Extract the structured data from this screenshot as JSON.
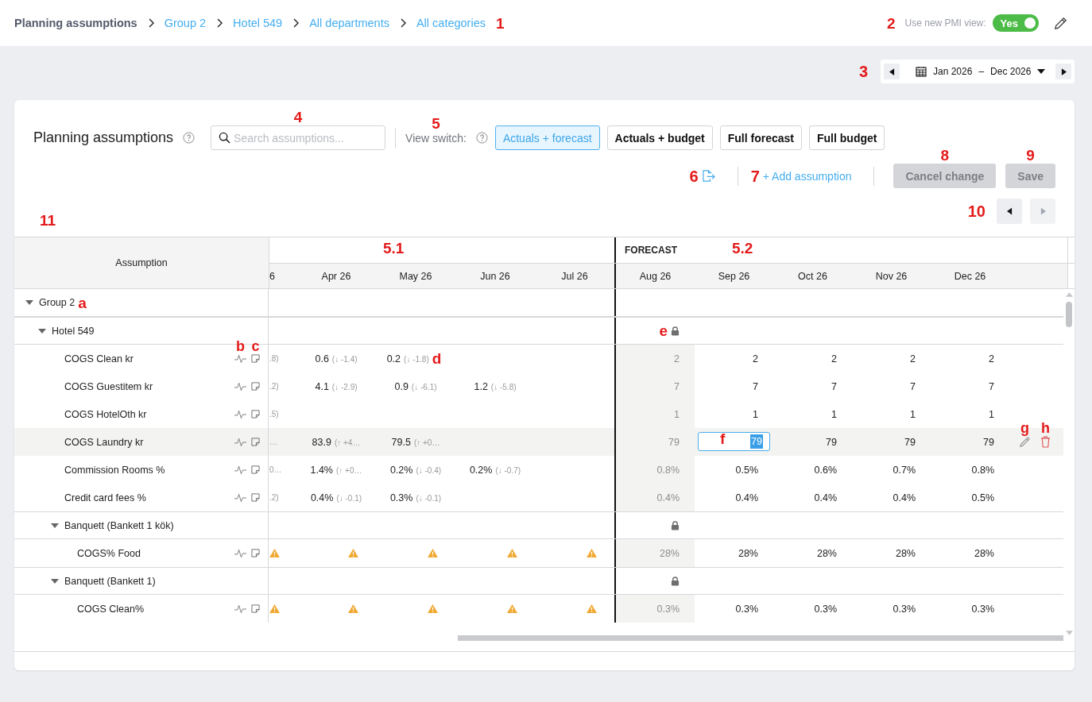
{
  "breadcrumbs": {
    "annotation": "1",
    "items": [
      {
        "label": "Planning assumptions",
        "kind": "current"
      },
      {
        "label": "Group 2",
        "kind": "link"
      },
      {
        "label": "Hotel 549",
        "kind": "link"
      },
      {
        "label": "All departments",
        "kind": "link"
      },
      {
        "label": "All categories",
        "kind": "link"
      }
    ]
  },
  "pmi_toggle": {
    "label": "Use new PMI view:",
    "on": true,
    "value": "Yes",
    "annotation": "2"
  },
  "date_range": {
    "from": "Jan 2026",
    "separator": "–",
    "to": "Dec 2026",
    "annotation": "3"
  },
  "card": {
    "title": "Planning assumptions",
    "search": {
      "placeholder": "Search assumptions...",
      "annotation": "4"
    },
    "view_switch": {
      "label": "View switch:",
      "annotation": "5",
      "options": [
        {
          "label": "Actuals + forecast",
          "selected": true
        },
        {
          "label": "Actuals + budget",
          "selected": false
        },
        {
          "label": "Full forecast",
          "selected": false
        },
        {
          "label": "Full budget",
          "selected": false
        }
      ]
    },
    "export_annotation": "6",
    "add_assumption": {
      "label": "+ Add assumption",
      "annotation": "7"
    },
    "cancel": {
      "label": "Cancel change",
      "disabled": true,
      "annotation": "8"
    },
    "save": {
      "label": "Save",
      "disabled": true,
      "annotation": "9"
    },
    "pager": {
      "annotation": "10",
      "buttons": [
        {
          "kind": "prev",
          "disabled": false
        },
        {
          "kind": "next",
          "disabled": true
        }
      ]
    },
    "table_annotation": "11"
  },
  "table": {
    "assumption_header": "Assumption",
    "actuals": {
      "annotation": "5.1",
      "months": [
        "6",
        "Apr 26",
        "May 26",
        "Jun 26",
        "Jul 26"
      ]
    },
    "forecast": {
      "title": "FORECAST",
      "annotation": "5.2",
      "months": [
        "Aug 26",
        "Sep 26",
        "Oct 26",
        "Nov 26",
        "Dec 26"
      ]
    },
    "rows": [
      {
        "kind": "group",
        "name": "Group 2",
        "expanded": true,
        "locked": false,
        "annotation": "a",
        "children": [
          {
            "kind": "group",
            "name": "Hotel 549",
            "expanded": true,
            "locked": true,
            "lock_annotation": "e",
            "children": [
              {
                "kind": "assumption",
                "name": "COGS Clean kr",
                "hovered": false,
                "icon_annotations": [
                  "b",
                  "c"
                ],
                "actuals": [
                  {
                    "kind": "value",
                    "value": ".8)"
                  },
                  {
                    "kind": "value",
                    "value": "0.6",
                    "delta": "(↓ -1.4)"
                  },
                  {
                    "kind": "value",
                    "value": "0.2",
                    "delta": "(↓ -1.8)",
                    "annotation": "d"
                  },
                  {
                    "kind": "empty"
                  },
                  {
                    "kind": "empty"
                  }
                ],
                "forecast": [
                  {
                    "kind": "actual",
                    "value": "2"
                  },
                  {
                    "kind": "value",
                    "value": "2"
                  },
                  {
                    "kind": "value",
                    "value": "2"
                  },
                  {
                    "kind": "value",
                    "value": "2"
                  },
                  {
                    "kind": "value",
                    "value": "2"
                  }
                ]
              },
              {
                "kind": "assumption",
                "name": "COGS Guestitem kr",
                "hovered": false,
                "actuals": [
                  {
                    "kind": "value",
                    "value": ".2)"
                  },
                  {
                    "kind": "value",
                    "value": "4.1",
                    "delta": "(↓ -2.9)"
                  },
                  {
                    "kind": "value",
                    "value": "0.9",
                    "delta": "(↓ -6.1)"
                  },
                  {
                    "kind": "value",
                    "value": "1.2",
                    "delta": "(↓ -5.8)"
                  },
                  {
                    "kind": "empty"
                  }
                ],
                "forecast": [
                  {
                    "kind": "actual",
                    "value": "7"
                  },
                  {
                    "kind": "value",
                    "value": "7"
                  },
                  {
                    "kind": "value",
                    "value": "7"
                  },
                  {
                    "kind": "value",
                    "value": "7"
                  },
                  {
                    "kind": "value",
                    "value": "7"
                  }
                ]
              },
              {
                "kind": "assumption",
                "name": "COGS HotelOth kr",
                "hovered": false,
                "actuals": [
                  {
                    "kind": "value",
                    "value": ".5)"
                  },
                  {
                    "kind": "empty"
                  },
                  {
                    "kind": "empty"
                  },
                  {
                    "kind": "empty"
                  },
                  {
                    "kind": "empty"
                  }
                ],
                "forecast": [
                  {
                    "kind": "actual",
                    "value": "1"
                  },
                  {
                    "kind": "value",
                    "value": "1"
                  },
                  {
                    "kind": "value",
                    "value": "1"
                  },
                  {
                    "kind": "value",
                    "value": "1"
                  },
                  {
                    "kind": "value",
                    "value": "1"
                  }
                ]
              },
              {
                "kind": "assumption",
                "name": "COGS Laundry kr",
                "hovered": true,
                "action_annotations": [
                  "g",
                  "h"
                ],
                "actuals": [
                  {
                    "kind": "value",
                    "value": "…"
                  },
                  {
                    "kind": "value",
                    "value": "83.9",
                    "delta": "(↑ +4…"
                  },
                  {
                    "kind": "value",
                    "value": "79.5",
                    "delta": "(↑ +0…"
                  },
                  {
                    "kind": "empty"
                  },
                  {
                    "kind": "empty"
                  }
                ],
                "forecast": [
                  {
                    "kind": "actual",
                    "value": "79"
                  },
                  {
                    "kind": "editing",
                    "value": "79",
                    "annotation": "f"
                  },
                  {
                    "kind": "value",
                    "value": "79"
                  },
                  {
                    "kind": "value",
                    "value": "79"
                  },
                  {
                    "kind": "value",
                    "value": "79"
                  }
                ]
              },
              {
                "kind": "assumption",
                "name": "Commission Rooms %",
                "hovered": false,
                "actuals": [
                  {
                    "kind": "value",
                    "value": "0…"
                  },
                  {
                    "kind": "value",
                    "value": "1.4%",
                    "delta": "(↑ +0…"
                  },
                  {
                    "kind": "value",
                    "value": "0.2%",
                    "delta": "(↓ -0.4)"
                  },
                  {
                    "kind": "value",
                    "value": "0.2%",
                    "delta": "(↓ -0.7)"
                  },
                  {
                    "kind": "empty"
                  }
                ],
                "forecast": [
                  {
                    "kind": "actual",
                    "value": "0.8%"
                  },
                  {
                    "kind": "value",
                    "value": "0.5%"
                  },
                  {
                    "kind": "value",
                    "value": "0.6%"
                  },
                  {
                    "kind": "value",
                    "value": "0.7%"
                  },
                  {
                    "kind": "value",
                    "value": "0.8%"
                  }
                ]
              },
              {
                "kind": "assumption",
                "name": "Credit card fees %",
                "hovered": false,
                "actuals": [
                  {
                    "kind": "value",
                    "value": ".2)"
                  },
                  {
                    "kind": "value",
                    "value": "0.4%",
                    "delta": "(↓ -0.1)"
                  },
                  {
                    "kind": "value",
                    "value": "0.3%",
                    "delta": "(↓ -0.1)"
                  },
                  {
                    "kind": "empty"
                  },
                  {
                    "kind": "empty"
                  }
                ],
                "forecast": [
                  {
                    "kind": "actual",
                    "value": "0.4%"
                  },
                  {
                    "kind": "value",
                    "value": "0.4%"
                  },
                  {
                    "kind": "value",
                    "value": "0.4%"
                  },
                  {
                    "kind": "value",
                    "value": "0.4%"
                  },
                  {
                    "kind": "value",
                    "value": "0.5%"
                  }
                ]
              },
              {
                "kind": "group",
                "name": "Banquett (Bankett 1 kök)",
                "expanded": true,
                "locked": true,
                "children": [
                  {
                    "kind": "assumption",
                    "name": "COGS% Food",
                    "hovered": false,
                    "actuals": [
                      {
                        "kind": "warning"
                      },
                      {
                        "kind": "warning"
                      },
                      {
                        "kind": "warning"
                      },
                      {
                        "kind": "warning"
                      },
                      {
                        "kind": "warning"
                      }
                    ],
                    "forecast": [
                      {
                        "kind": "actual",
                        "value": "28%"
                      },
                      {
                        "kind": "value",
                        "value": "28%"
                      },
                      {
                        "kind": "value",
                        "value": "28%"
                      },
                      {
                        "kind": "value",
                        "value": "28%"
                      },
                      {
                        "kind": "value",
                        "value": "28%"
                      }
                    ]
                  }
                ]
              },
              {
                "kind": "group",
                "name": "Banquett (Bankett 1)",
                "expanded": true,
                "locked": true,
                "children": [
                  {
                    "kind": "assumption",
                    "name": "COGS Clean%",
                    "hovered": false,
                    "actuals": [
                      {
                        "kind": "warning"
                      },
                      {
                        "kind": "warning"
                      },
                      {
                        "kind": "warning"
                      },
                      {
                        "kind": "warning"
                      },
                      {
                        "kind": "warning"
                      }
                    ],
                    "forecast": [
                      {
                        "kind": "actual",
                        "value": "0.3%"
                      },
                      {
                        "kind": "value",
                        "value": "0.3%"
                      },
                      {
                        "kind": "value",
                        "value": "0.3%"
                      },
                      {
                        "kind": "value",
                        "value": "0.3%"
                      },
                      {
                        "kind": "value",
                        "value": "0.3%"
                      }
                    ]
                  }
                ]
              }
            ]
          }
        ]
      }
    ]
  }
}
